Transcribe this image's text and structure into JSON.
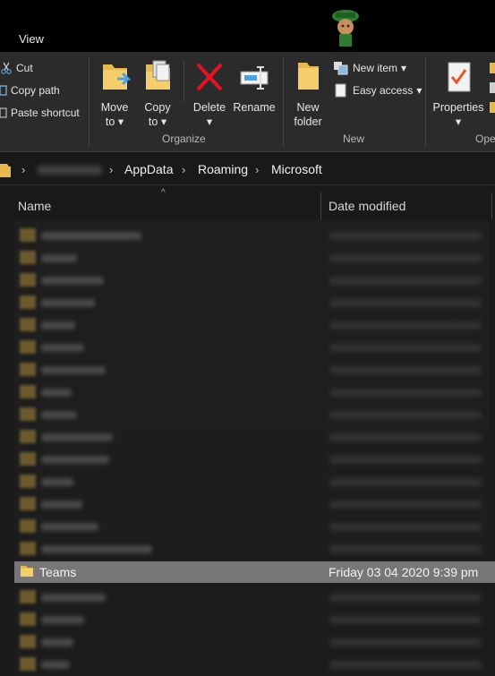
{
  "ribbon": {
    "tab_view": "View",
    "clipboard": {
      "cut": "Cut",
      "copy_path": "Copy path",
      "paste_shortcut": "Paste shortcut"
    },
    "organize": {
      "label": "Organize",
      "move_to_line1": "Move",
      "move_to_line2": "to",
      "copy_to_line1": "Copy",
      "copy_to_line2": "to",
      "delete": "Delete",
      "rename": "Rename"
    },
    "new_group": {
      "label": "New",
      "new_folder_line1": "New",
      "new_folder_line2": "folder",
      "new_item": "New item",
      "easy_access": "Easy access"
    },
    "open": {
      "label": "Ope",
      "properties": "Properties"
    }
  },
  "address": {
    "crumbs": [
      "AppData",
      "Roaming",
      "Microsoft"
    ]
  },
  "columns": {
    "name": "Name",
    "date_modified": "Date modified"
  },
  "files": {
    "selected": {
      "name": "Teams",
      "date": "Friday 03 04 2020 9:39 pm"
    }
  },
  "colors": {
    "folder": "#e8b84a",
    "selected_row": "#777777",
    "delete_red": "#e81123",
    "accent_blue": "#4aa3e8"
  }
}
